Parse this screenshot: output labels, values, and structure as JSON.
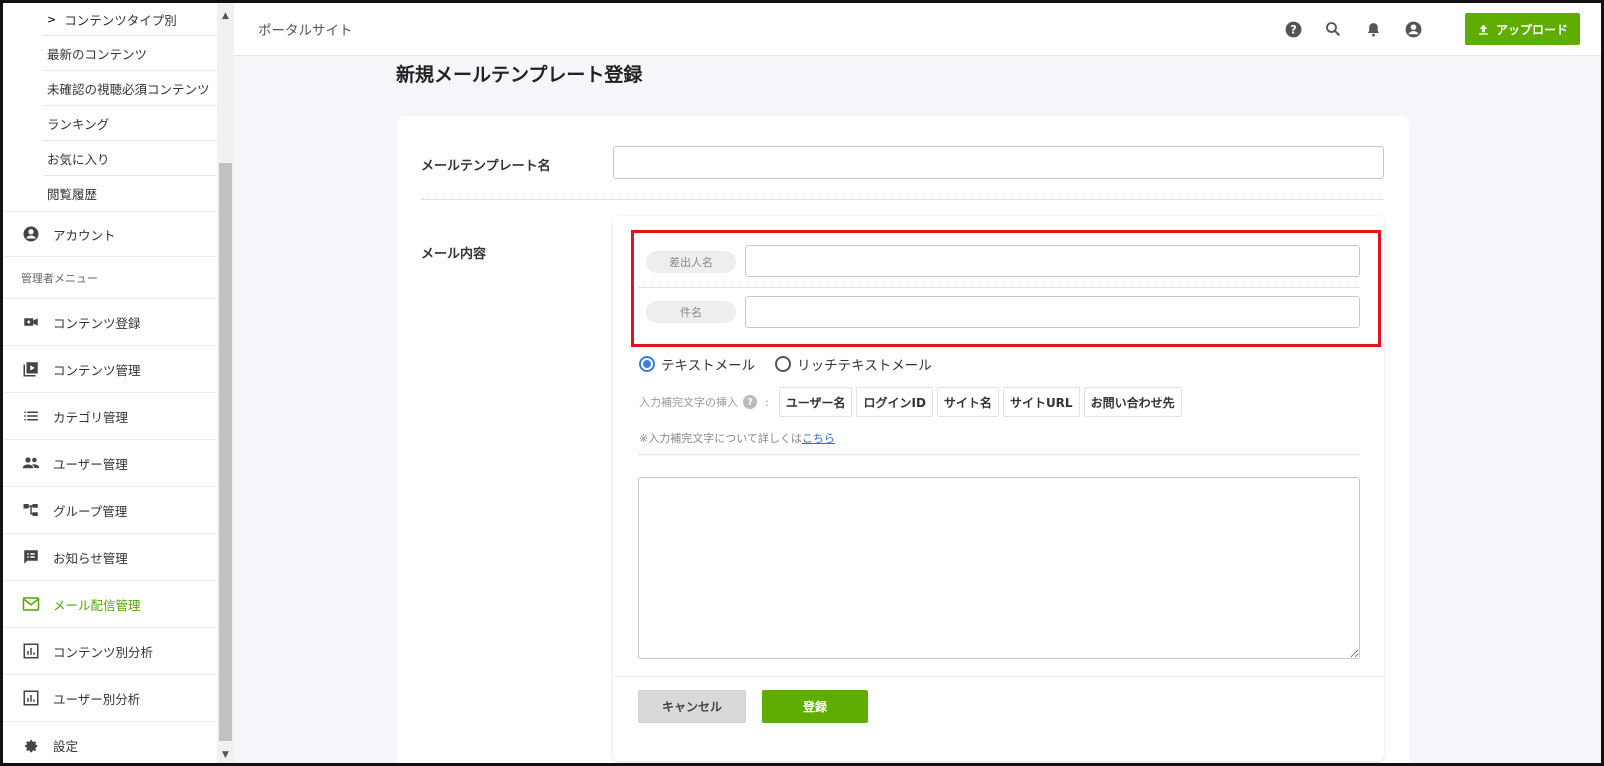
{
  "sidebar": {
    "sub_items": [
      {
        "label": "コンテンツタイプ別"
      },
      {
        "label": "最新のコンテンツ"
      },
      {
        "label": "未確認の視聴必須コンテンツ"
      },
      {
        "label": "ランキング"
      },
      {
        "label": "お気に入り"
      },
      {
        "label": "閲覧履歴"
      }
    ],
    "account_label": "アカウント",
    "admin_heading": "管理者メニュー",
    "admin_items": [
      {
        "label": "コンテンツ登録",
        "icon": "video-camera-icon"
      },
      {
        "label": "コンテンツ管理",
        "icon": "video-library-icon"
      },
      {
        "label": "カテゴリ管理",
        "icon": "list-icon"
      },
      {
        "label": "ユーザー管理",
        "icon": "users-icon"
      },
      {
        "label": "グループ管理",
        "icon": "hierarchy-icon"
      },
      {
        "label": "お知らせ管理",
        "icon": "announcement-icon"
      },
      {
        "label": "メール配信管理",
        "icon": "mail-icon"
      },
      {
        "label": "コンテンツ別分析",
        "icon": "chart-icon"
      },
      {
        "label": "ユーザー別分析",
        "icon": "chart-icon"
      },
      {
        "label": "設定",
        "icon": "gear-icon"
      }
    ]
  },
  "header": {
    "site_title": "ポータルサイト",
    "upload_label": "アップロード"
  },
  "main": {
    "page_title": "新規メールテンプレート登録",
    "template_name_label": "メールテンプレート名",
    "template_name_value": "",
    "mail_content_label": "メール内容",
    "sender_label": "差出人名",
    "sender_value": "",
    "subject_label": "件名",
    "subject_value": "",
    "radio_text": "テキストメール",
    "radio_rich": "リッチテキストメール",
    "insert_label": "入力補完文字の挿入",
    "insert_chips": [
      "ユーザー名",
      "ログインID",
      "サイト名",
      "サイトURL",
      "お問い合わせ先"
    ],
    "note_prefix": "※入力補完文字について詳しくは",
    "note_link": "こちら",
    "body_value": "",
    "cancel_label": "キャンセル",
    "submit_label": "登録"
  },
  "colors": {
    "accent_green": "#5fad00",
    "highlight_red": "#e3121f",
    "radio_blue": "#3b7ddd"
  }
}
